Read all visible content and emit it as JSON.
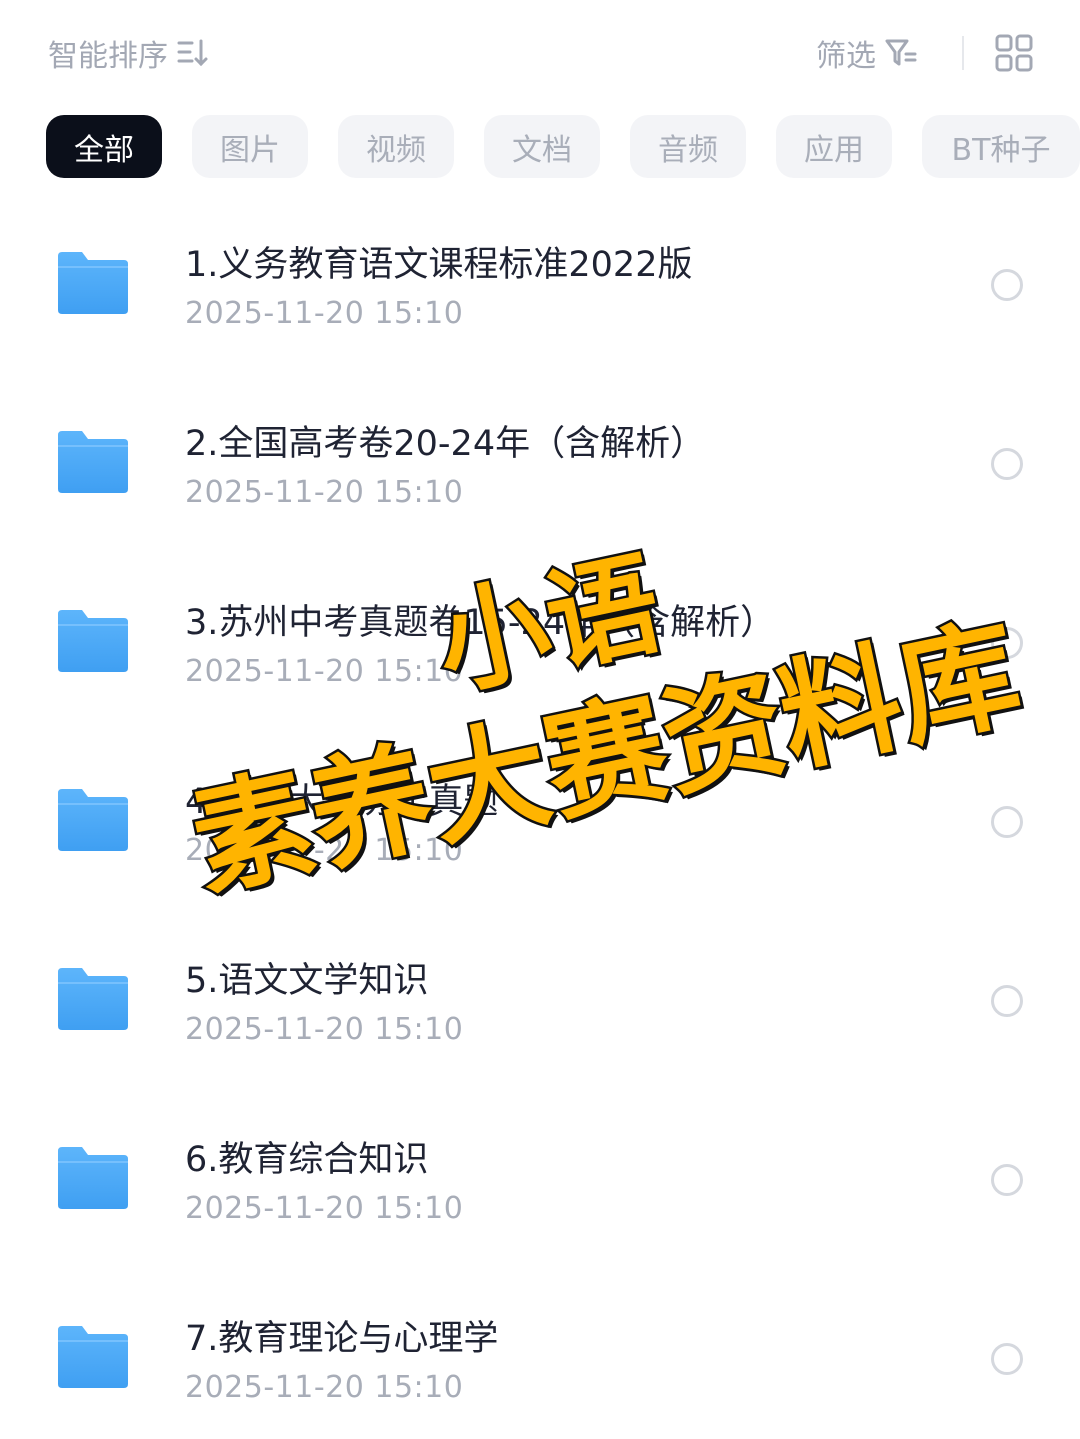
{
  "header": {
    "sort_label": "智能排序",
    "sort_icon": "sort-descending-icon",
    "filter_label": "筛选",
    "filter_icon": "filter-icon",
    "view_icon": "grid-view-icon"
  },
  "tabs": [
    {
      "label": "全部",
      "active": true
    },
    {
      "label": "图片",
      "active": false
    },
    {
      "label": "视频",
      "active": false
    },
    {
      "label": "文档",
      "active": false
    },
    {
      "label": "音频",
      "active": false
    },
    {
      "label": "应用",
      "active": false
    },
    {
      "label": "BT种子",
      "active": false
    }
  ],
  "files": [
    {
      "name": "1.义务教育语文课程标准2022版",
      "time": "2025-11-20  15:10"
    },
    {
      "name": "2.全国高考卷20-24年（含解析）",
      "time": "2025-11-20  15:10"
    },
    {
      "name": "3.苏州中考真题卷15-24年（含解析）",
      "time": "2025-11-20  15:10"
    },
    {
      "name": "4.素养大赛历年真题",
      "time": "2025-11-20  15:10"
    },
    {
      "name": "5.语文文学知识",
      "time": "2025-11-20  15:10"
    },
    {
      "name": "6.教育综合知识",
      "time": "2025-11-20  15:10"
    },
    {
      "name": "7.教育理论与心理学",
      "time": "2025-11-20  15:10"
    }
  ],
  "overlay": {
    "line1": "小语",
    "line2": "素养大赛资料库"
  },
  "colors": {
    "folder": "#4aa8f5",
    "active_tab": "#0b0f1a",
    "stamp_fill": "#ffb400"
  }
}
